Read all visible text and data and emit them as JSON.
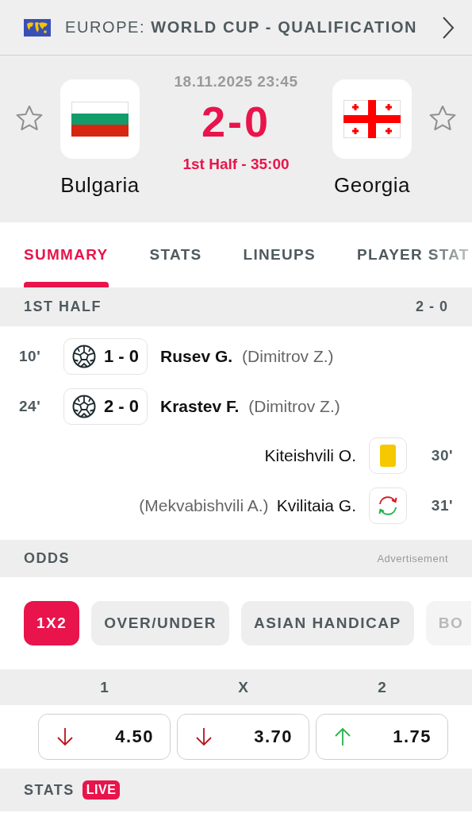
{
  "header": {
    "region": "EUROPE:",
    "competition": "WORLD CUP - QUALIFICATION"
  },
  "match": {
    "datetime": "18.11.2025 23:45",
    "score": "2-0",
    "status": "1st Half - 35:00",
    "home": {
      "name": "Bulgaria",
      "flag": {
        "kind": "bulgaria"
      },
      "favorite": false
    },
    "away": {
      "name": "Georgia",
      "flag": {
        "kind": "georgia"
      },
      "favorite": false
    }
  },
  "tabs": [
    {
      "label": "SUMMARY",
      "selected": true
    },
    {
      "label": "STATS",
      "selected": false
    },
    {
      "label": "LINEUPS",
      "selected": false
    },
    {
      "label": "PLAYER STAT",
      "selected": false
    }
  ],
  "period": {
    "title": "1ST HALF",
    "score": "2 - 0"
  },
  "events": [
    {
      "kind": "goal",
      "away": false,
      "minute": "10'",
      "score": "1 - 0",
      "player": "Rusev G.",
      "assist": "(Dimitrov Z.)"
    },
    {
      "kind": "goal",
      "away": false,
      "minute": "24'",
      "score": "2 - 0",
      "player": "Krastev F.",
      "assist": "(Dimitrov Z.)"
    },
    {
      "kind": "yellow_card",
      "away": true,
      "minute": "30'",
      "player": "Kiteishvili O."
    },
    {
      "kind": "substitution",
      "away": true,
      "minute": "31'",
      "player": "Kvilitaia G.",
      "assist": "(Mekvabishvili A.)"
    }
  ],
  "odds": {
    "title": "ODDS",
    "note": "Advertisement",
    "markets": [
      {
        "label": "1X2",
        "selected": true
      },
      {
        "label": "OVER/UNDER",
        "selected": false
      },
      {
        "label": "ASIAN HANDICAP",
        "selected": false
      },
      {
        "label": "BO",
        "selected": false
      }
    ],
    "columns": [
      {
        "label": "1",
        "value": "4.50",
        "kind": "down"
      },
      {
        "label": "X",
        "value": "3.70",
        "kind": "down"
      },
      {
        "label": "2",
        "value": "1.75",
        "kind": "up"
      }
    ]
  },
  "stats": {
    "title": "STATS",
    "badge": "LIVE"
  }
}
